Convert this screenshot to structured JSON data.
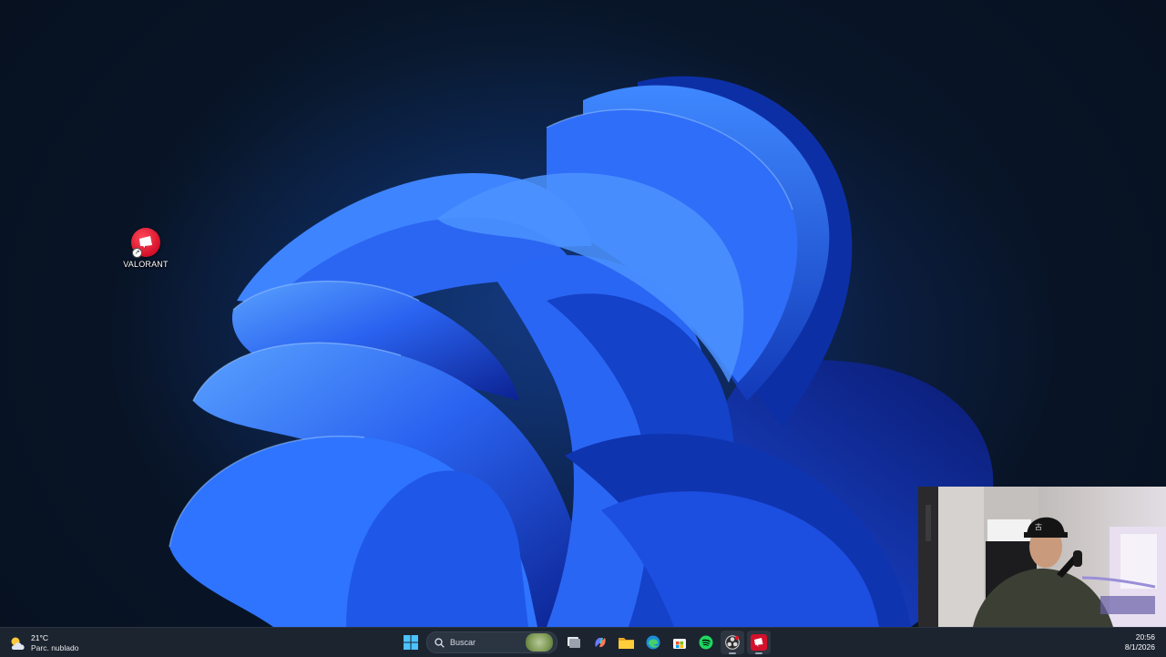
{
  "desktop": {
    "icons": [
      {
        "label": "VALORANT",
        "icon": "riot-client-icon"
      }
    ]
  },
  "taskbar": {
    "weather": {
      "temp": "21°C",
      "desc": "Parc. nublado",
      "icon": "partly-cloudy-icon"
    },
    "search": {
      "placeholder": "Buscar"
    },
    "apps": [
      {
        "name": "start",
        "icon": "windows-start-icon"
      },
      {
        "name": "search",
        "icon": "search-icon"
      },
      {
        "name": "task-view",
        "icon": "task-view-icon"
      },
      {
        "name": "copilot",
        "icon": "copilot-icon"
      },
      {
        "name": "file-explorer",
        "icon": "folder-icon"
      },
      {
        "name": "edge",
        "icon": "edge-icon"
      },
      {
        "name": "store",
        "icon": "store-icon"
      },
      {
        "name": "spotify",
        "icon": "spotify-icon"
      },
      {
        "name": "obs",
        "icon": "obs-icon"
      },
      {
        "name": "riot-client",
        "icon": "riot-client-icon"
      }
    ],
    "clock": {
      "time": "20:56",
      "date": "8/1/2026"
    }
  },
  "colors": {
    "taskbar": "#1c2430",
    "bloom_light": "#2f7bff",
    "bloom_dark": "#0b2fa8",
    "riot_red": "#d4102a",
    "spotify_green": "#1ed760"
  }
}
